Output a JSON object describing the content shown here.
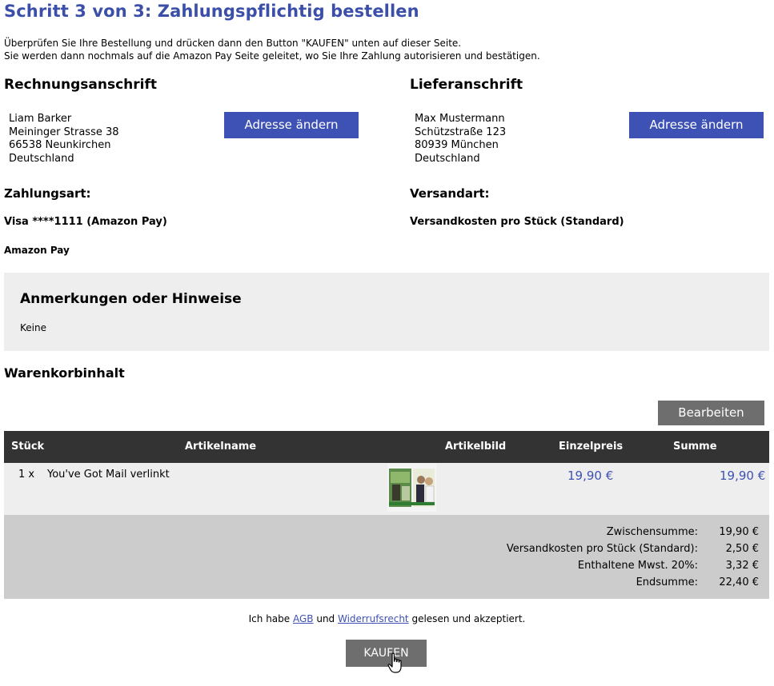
{
  "header": {
    "title": "Schritt 3 von 3: Zahlungspflichtig bestellen",
    "intro_line1": "Überprüfen Sie Ihre Bestellung und drücken dann den Button \"KAUFEN\" unten auf dieser Seite.",
    "intro_line2": "Sie werden dann nochmals auf die Amazon Pay Seite geleitet, wo Sie Ihre Zahlung autorisieren und bestätigen."
  },
  "billing": {
    "heading": "Rechnungsanschrift",
    "name": "Liam Barker",
    "street": "Meininger Strasse 38",
    "city": "66538 Neunkirchen",
    "country": "Deutschland",
    "change_button": "Adresse ändern"
  },
  "shipping": {
    "heading": "Lieferanschrift",
    "name": "Max Mustermann",
    "street": "Schützstraße 123",
    "city": "80939 München",
    "country": "Deutschland",
    "change_button": "Adresse ändern"
  },
  "payment": {
    "heading": "Zahlungsart:",
    "method": "Visa ****1111 (Amazon Pay)",
    "provider": "Amazon Pay"
  },
  "delivery": {
    "heading": "Versandart:",
    "method": "Versandkosten pro Stück (Standard)"
  },
  "notes": {
    "heading": "Anmerkungen oder Hinweise",
    "text": "Keine"
  },
  "cart": {
    "heading": "Warenkorbinhalt",
    "edit_button": "Bearbeiten",
    "columns": [
      "Stück",
      "Artikelname",
      "Artikelbild",
      "Einzelpreis",
      "Summe"
    ],
    "items": [
      {
        "qty": "1 x",
        "name": "You've Got Mail verlinkt",
        "unit_price": "19,90 €",
        "total": "19,90 €"
      }
    ]
  },
  "totals": {
    "subtotal_label": "Zwischensumme:",
    "subtotal_value": "19,90 €",
    "shipping_label": "Versandkosten pro Stück (Standard):",
    "shipping_value": "2,50 €",
    "vat_label": "Enthaltene Mwst. 20%:",
    "vat_value": "3,32 €",
    "total_label": "Endsumme:",
    "total_value": "22,40 €"
  },
  "terms": {
    "prefix": "Ich habe",
    "agb_link": "AGB",
    "and": "und",
    "widerruf_link": "Widerrufsrecht",
    "suffix": "gelesen und akzeptiert."
  },
  "buy_button": "KAUFEN",
  "colors": {
    "accent_blue": "#3e51b5",
    "title_blue": "#3b4fa8",
    "table_header": "#333333",
    "button_gray": "#6e6e6e"
  }
}
